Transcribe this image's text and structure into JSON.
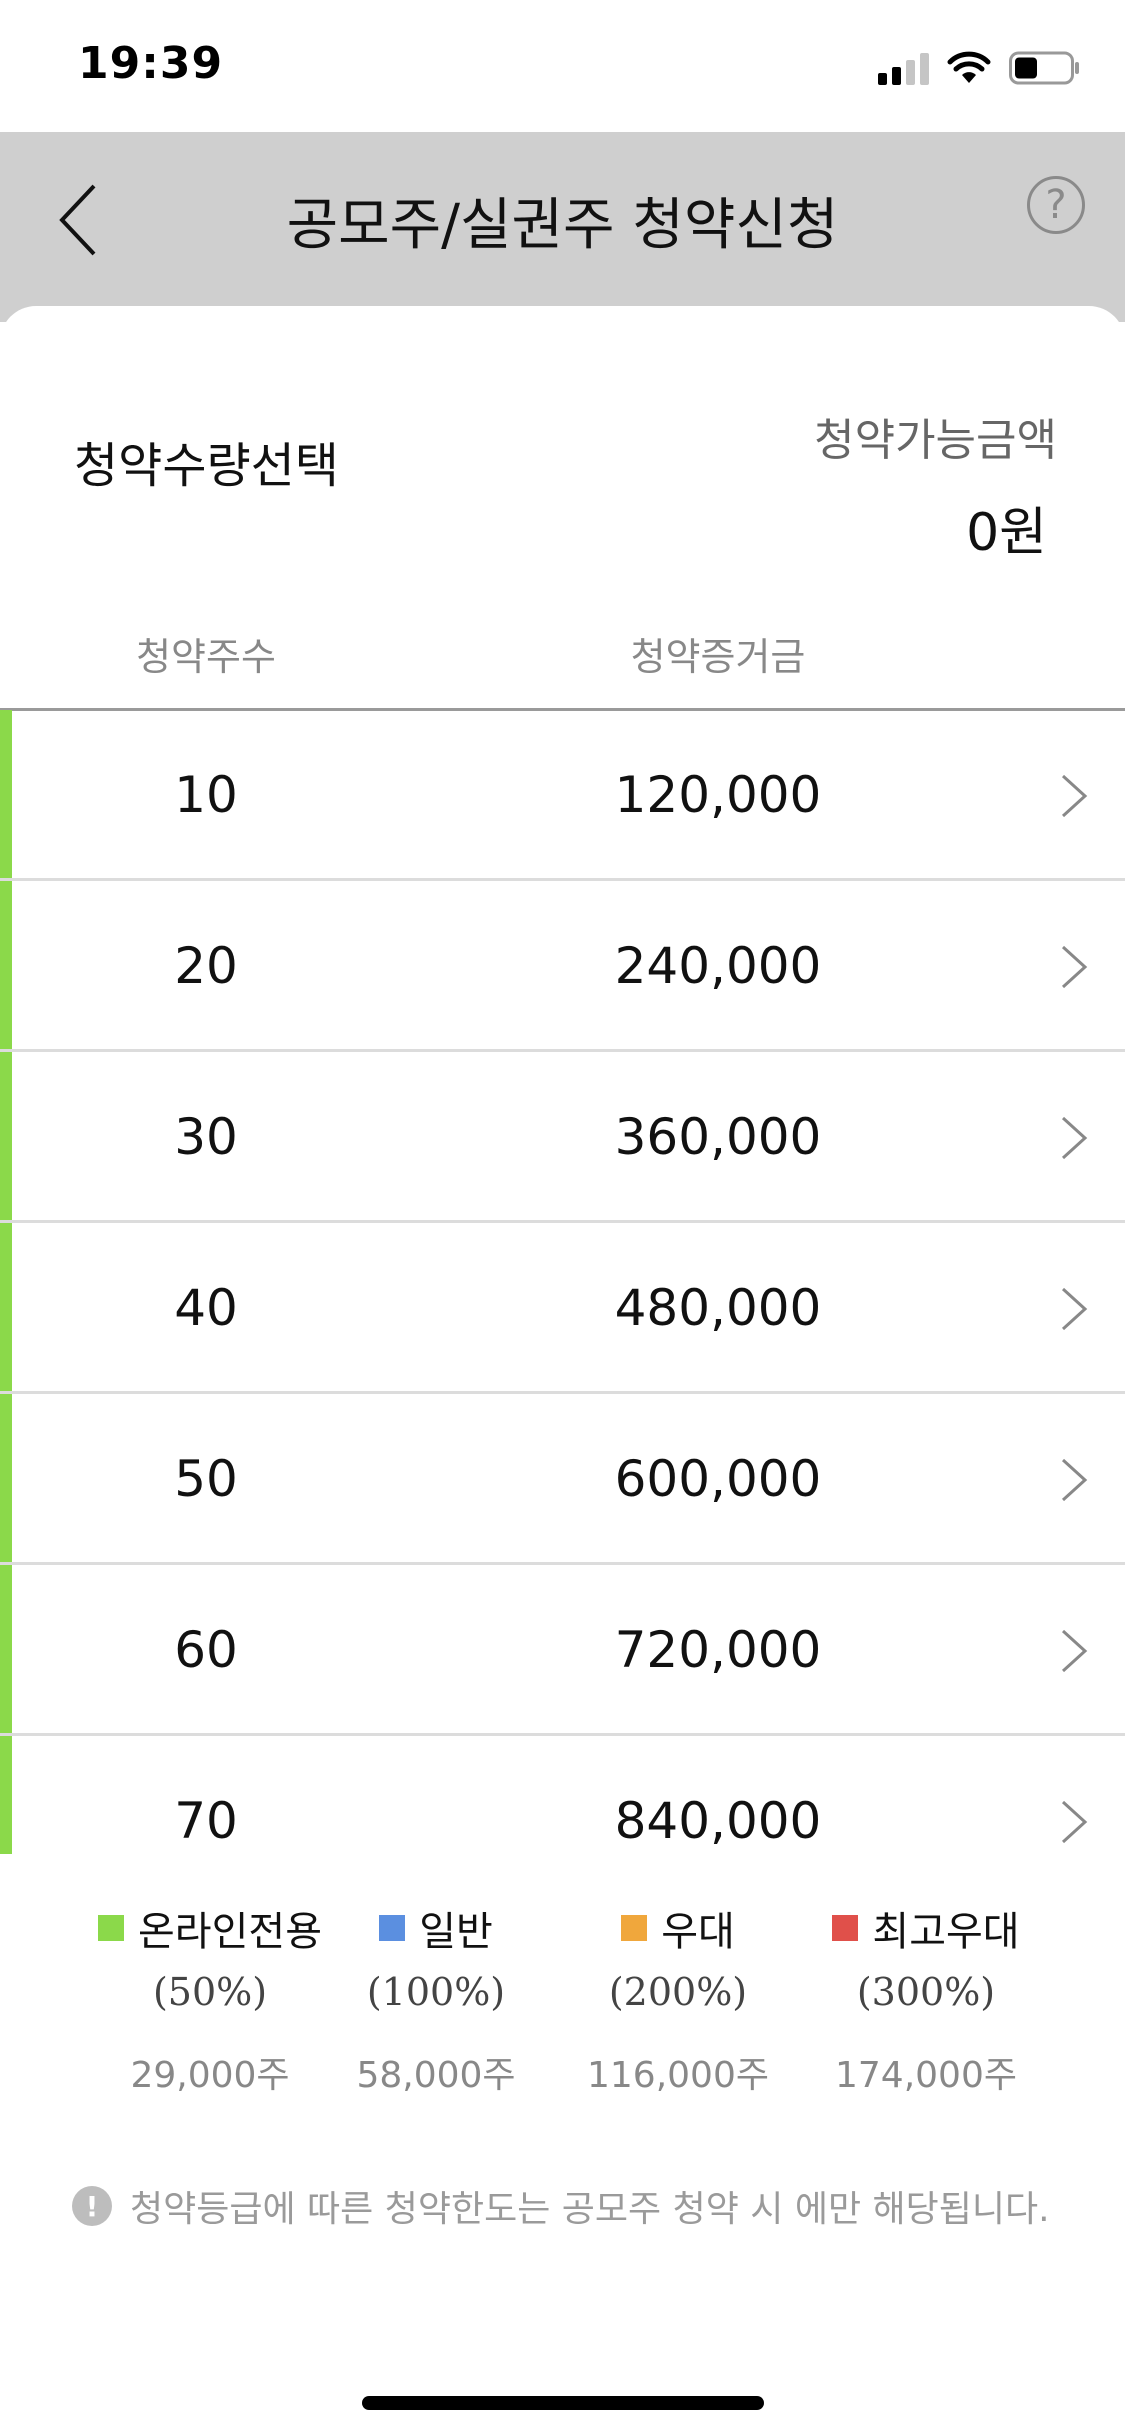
{
  "status_bar": {
    "time": "19:39",
    "icons": [
      "signal-icon",
      "wifi-icon",
      "battery-icon"
    ]
  },
  "header": {
    "title": "공모주/실권주 청약신청",
    "back_icon": "chevron-left-icon",
    "help_icon": "question-icon",
    "help_glyph": "?"
  },
  "summary": {
    "qty_title": "청약수량선택",
    "available_label": "청약가능금액",
    "available_value": "0원"
  },
  "table": {
    "headers": {
      "shares": "청약주수",
      "deposit": "청약증거금"
    },
    "accent_color": "#8bd94a",
    "rows": [
      {
        "shares": "10",
        "deposit": "120,000"
      },
      {
        "shares": "20",
        "deposit": "240,000"
      },
      {
        "shares": "30",
        "deposit": "360,000"
      },
      {
        "shares": "40",
        "deposit": "480,000"
      },
      {
        "shares": "50",
        "deposit": "600,000"
      },
      {
        "shares": "60",
        "deposit": "720,000"
      },
      {
        "shares": "70",
        "deposit": "840,000"
      }
    ]
  },
  "legend": [
    {
      "name": "온라인전용",
      "percent": "(50%)",
      "quantity": "29,000주",
      "color": "#8bd94a"
    },
    {
      "name": "일반",
      "percent": "(100%)",
      "quantity": "58,000주",
      "color": "#5b8fe0"
    },
    {
      "name": "우대",
      "percent": "(200%)",
      "quantity": "116,000주",
      "color": "#f0a73c"
    },
    {
      "name": "최고우대",
      "percent": "(300%)",
      "quantity": "174,000주",
      "color": "#e0504a"
    }
  ],
  "notice": {
    "icon": "exclamation-icon",
    "icon_glyph": "!",
    "text": "청약등급에 따른 청약한도는 공모주 청약 시 에만 해당됩니다."
  }
}
